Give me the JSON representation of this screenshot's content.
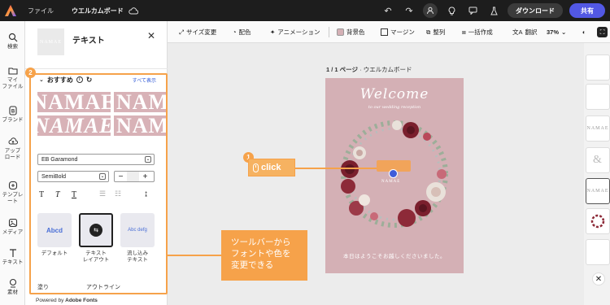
{
  "topbar": {
    "menu_file": "ファイル",
    "doc_title": "ウエルカムボード",
    "download": "ダウンロード",
    "share": "共有"
  },
  "rail": {
    "search": "検索",
    "myfile1": "マイ",
    "myfile2": "ファイル",
    "brand": "ブランド",
    "upload1": "アップ",
    "upload2": "ロード",
    "template": "テンプレート",
    "media": "メディア",
    "text": "テキスト",
    "assets": "素材"
  },
  "panel": {
    "thumb_text": "NAMAE",
    "title": "テキスト",
    "recommended": "おすすめ",
    "show_all": "すべて表示",
    "font_tile": "NAMAE",
    "font_family": "EB Garamond",
    "font_weight": "SemiBold",
    "presets": [
      {
        "label1": "デフォルト",
        "label2": "",
        "preview": "Abcd"
      },
      {
        "label1": "テキスト",
        "label2": "レイアウト",
        "preview": ""
      },
      {
        "label1": "流し込み",
        "label2": "テキスト",
        "preview": "Abc defg"
      }
    ],
    "fill_label": "塗り",
    "outline_label": "アウトライン",
    "powered_prefix": "Powered by ",
    "powered_brand": "Adobe Fonts"
  },
  "context_toolbar": {
    "resize": "サイズ変更",
    "color": "配色",
    "animation": "アニメーション",
    "background": "背景色",
    "margin": "マージン",
    "arrange": "整列",
    "bulk": "一括作成",
    "translate": "翻訳",
    "zoom": "37%"
  },
  "canvas": {
    "page_label_prefix": "1 / 1 ページ",
    "page_label_name": "ウエルカムボード",
    "welcome": "Welcome",
    "welcome_sub": "to our wedding reception",
    "namae": "NAMAE",
    "footer": "本日はようこそお越しくださいました。"
  },
  "annotations": {
    "step1": "1",
    "step2": "2",
    "click": "click",
    "note_line1": "ツールバーから",
    "note_line2": "フォントや色を",
    "note_line3": "変更できる"
  },
  "page_rail": {
    "thumb_text": "NAMAE",
    "amp": "&"
  },
  "colors": {
    "accent_orange": "#f6a24a",
    "share_blue": "#5258e4",
    "page_pink": "#d4b0b5"
  }
}
